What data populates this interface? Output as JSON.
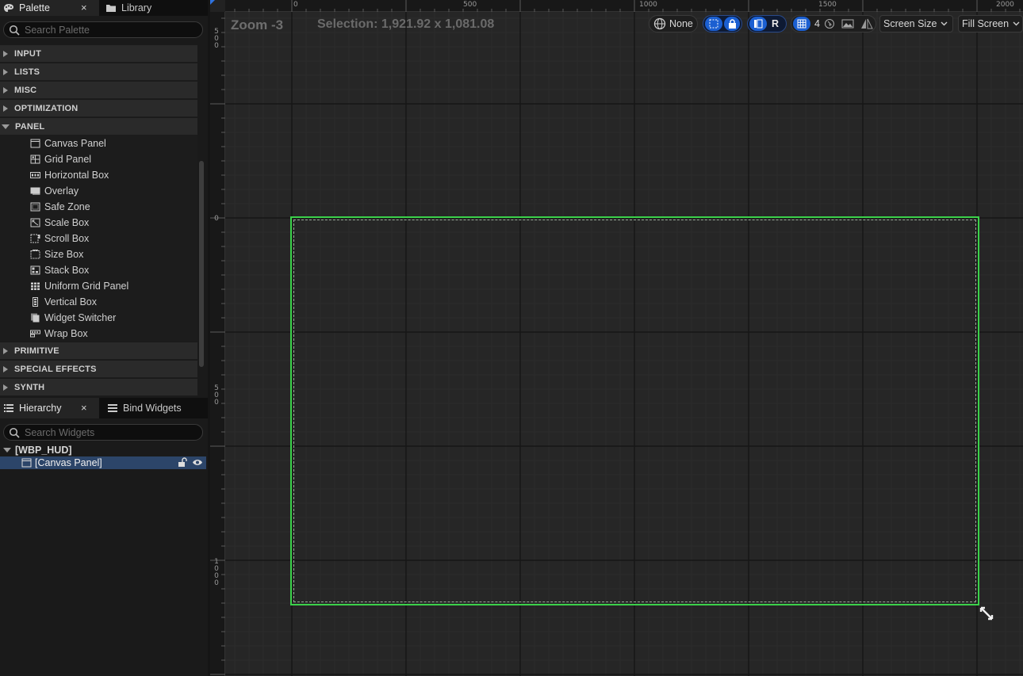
{
  "palette": {
    "tab_label": "Palette",
    "library_label": "Library",
    "close_glyph": "×",
    "search_placeholder": "Search Palette",
    "categories_top": [
      "INPUT",
      "LISTS",
      "MISC",
      "OPTIMIZATION",
      "PANEL"
    ],
    "panel_items": [
      {
        "label": "Canvas Panel",
        "icon": "canvas-panel-icon"
      },
      {
        "label": "Grid Panel",
        "icon": "grid-panel-icon"
      },
      {
        "label": "Horizontal Box",
        "icon": "horizontal-box-icon"
      },
      {
        "label": "Overlay",
        "icon": "overlay-icon"
      },
      {
        "label": "Safe Zone",
        "icon": "safe-zone-icon"
      },
      {
        "label": "Scale Box",
        "icon": "scale-box-icon"
      },
      {
        "label": "Scroll Box",
        "icon": "scroll-box-icon"
      },
      {
        "label": "Size Box",
        "icon": "size-box-icon"
      },
      {
        "label": "Stack Box",
        "icon": "stack-box-icon"
      },
      {
        "label": "Uniform Grid Panel",
        "icon": "uniform-grid-panel-icon"
      },
      {
        "label": "Vertical Box",
        "icon": "vertical-box-icon"
      },
      {
        "label": "Widget Switcher",
        "icon": "widget-switcher-icon"
      },
      {
        "label": "Wrap Box",
        "icon": "wrap-box-icon"
      }
    ],
    "categories_bottom": [
      "PRIMITIVE",
      "SPECIAL EFFECTS",
      "SYNTH"
    ]
  },
  "hierarchy": {
    "tab_label": "Hierarchy",
    "bind_label": "Bind Widgets",
    "close_glyph": "×",
    "search_placeholder": "Search Widgets",
    "root_label": "[WBP_HUD]",
    "child_label": "[Canvas Panel]"
  },
  "designer": {
    "zoom_label": "Zoom -3",
    "selection_label": "Selection: 1,921.92 x 1,081.08",
    "localize_label": "None",
    "r_label": "R",
    "grid_snap_value": "4",
    "screen_size_label": "Screen Size",
    "fill_screen_label": "Fill Screen",
    "ruler_top_labels": [
      "0",
      "500",
      "1000",
      "1500",
      "2000"
    ],
    "ruler_left_labels": [
      "500",
      "0",
      "500",
      "1000"
    ],
    "selection_color": "#3bd14a",
    "accent_color": "#1b5fd1"
  }
}
